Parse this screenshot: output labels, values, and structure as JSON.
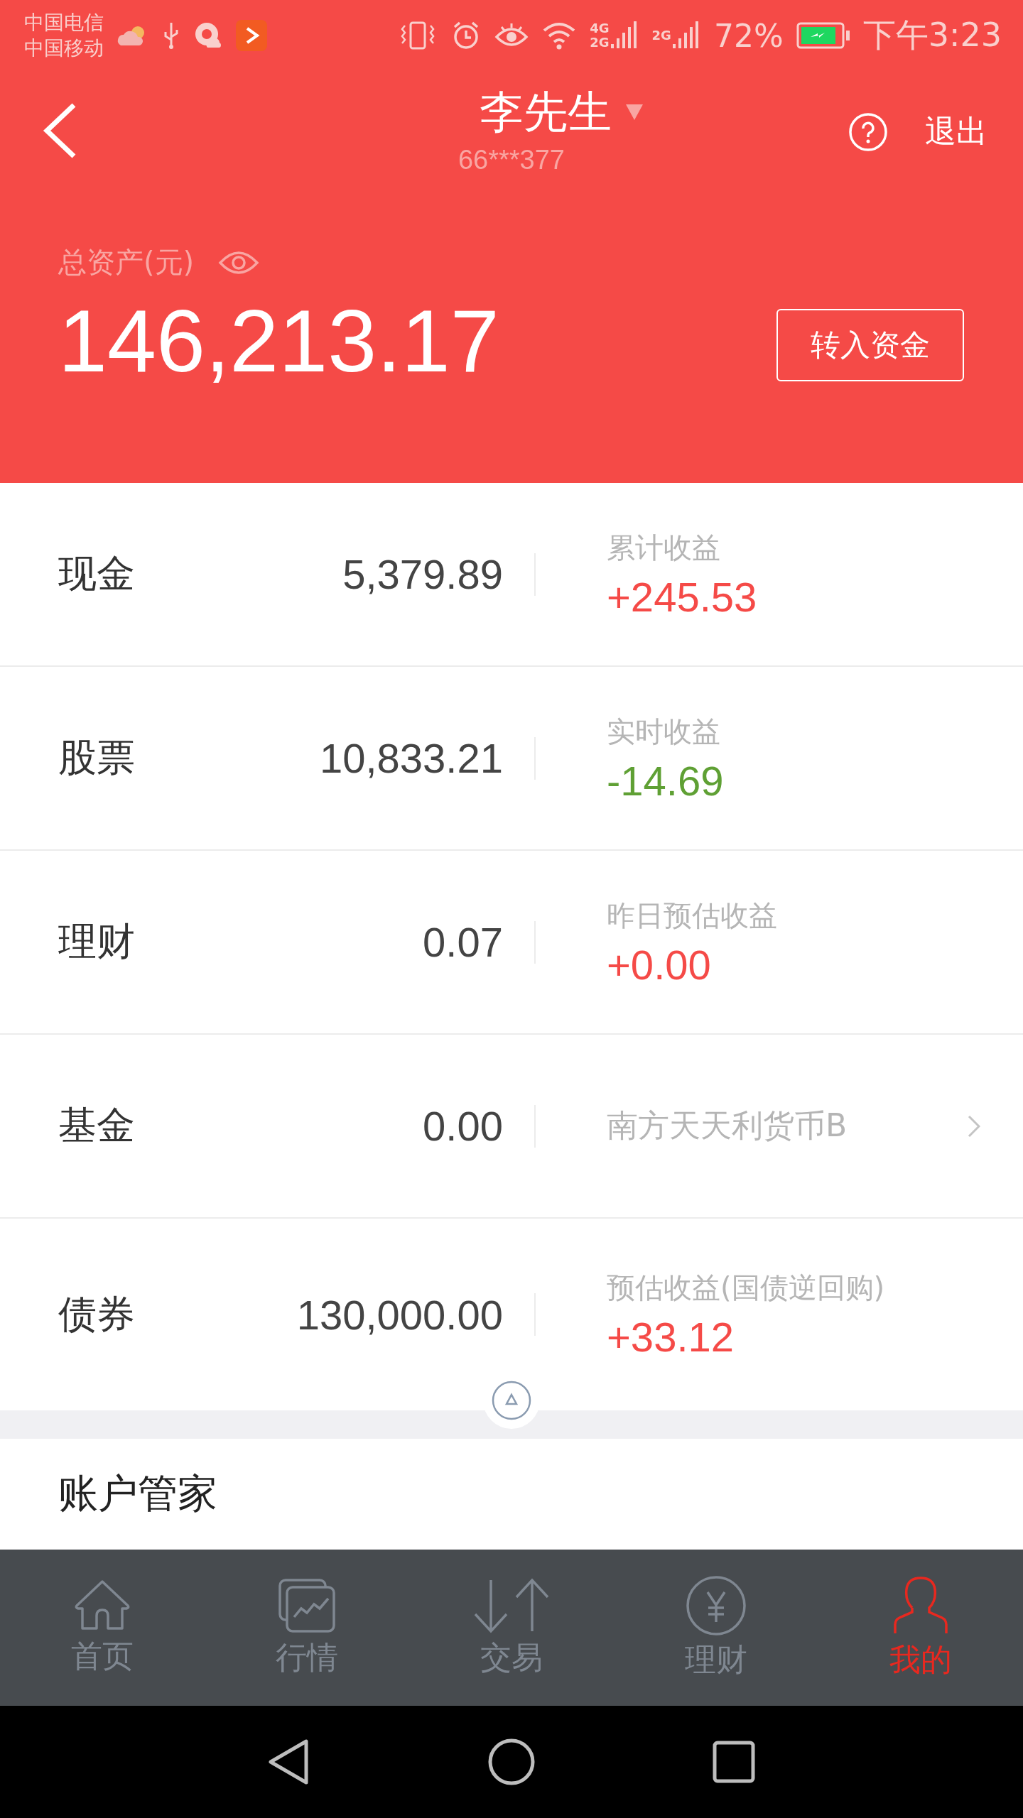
{
  "status_bar": {
    "carriers": [
      "中国电信",
      "中国移动"
    ],
    "network_labels": [
      {
        "top": "4G",
        "bottom": "2G"
      },
      {
        "top": "2G"
      }
    ],
    "battery_percent": "72%",
    "charging": true,
    "time": "下午3:23"
  },
  "header": {
    "title": "李先生",
    "account": "66***377",
    "logout": "退出"
  },
  "summary": {
    "label": "总资产(元)",
    "total": "146,213.17",
    "button": "转入资金"
  },
  "rows": [
    {
      "kind": "earning",
      "label": "现金",
      "amount": "5,379.89",
      "caption": "累计收益",
      "value": "+245.53",
      "color": "#f54a47"
    },
    {
      "kind": "earning",
      "label": "股票",
      "amount": "10,833.21",
      "caption": "实时收益",
      "value": "-14.69",
      "color": "#5fa034"
    },
    {
      "kind": "earning",
      "label": "理财",
      "amount": "0.07",
      "caption": "昨日预估收益",
      "value": "+0.00",
      "color": "#f54a47"
    },
    {
      "kind": "link",
      "label": "基金",
      "amount": "0.00",
      "caption": "南方天天利货币B"
    },
    {
      "kind": "earning",
      "label": "债券",
      "amount": "130,000.00",
      "caption": "预估收益(国债逆回购)",
      "value": "+33.12",
      "color": "#f54a47"
    }
  ],
  "section_title": "账户管家",
  "tabs": [
    {
      "label": "首页",
      "selected": false
    },
    {
      "label": "行情",
      "selected": false
    },
    {
      "label": "交易",
      "selected": false
    },
    {
      "label": "理财",
      "selected": false
    },
    {
      "label": "我的",
      "selected": true
    }
  ]
}
